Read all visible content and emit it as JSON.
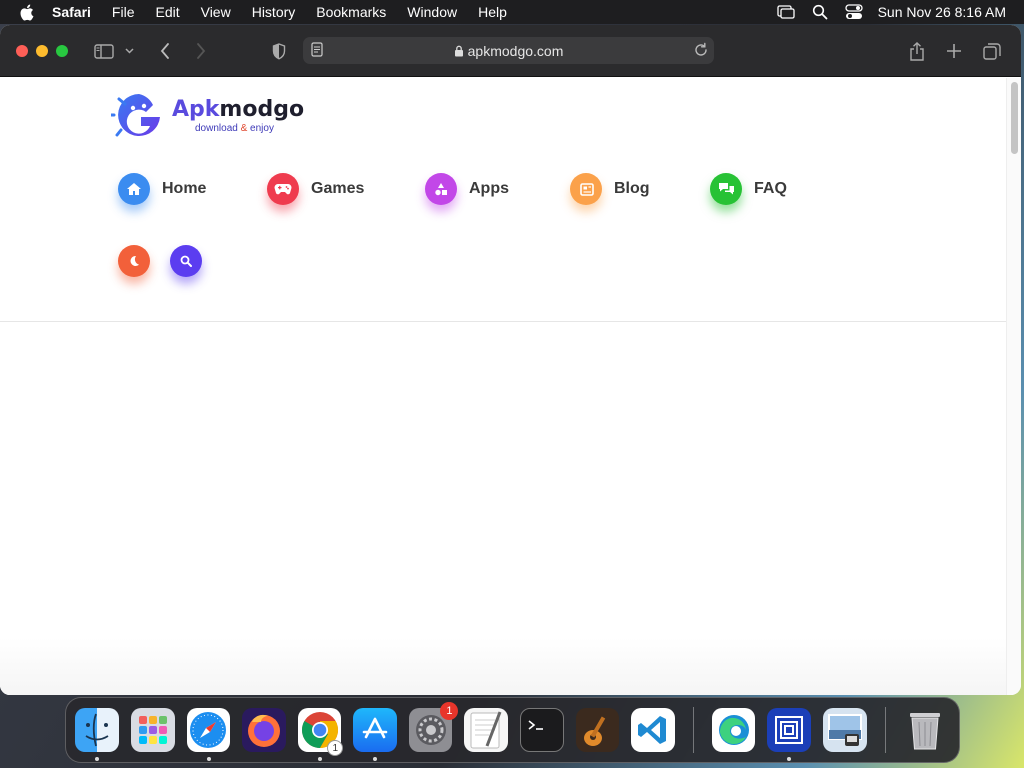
{
  "menubar": {
    "app_name": "Safari",
    "items": [
      "File",
      "Edit",
      "View",
      "History",
      "Bookmarks",
      "Window",
      "Help"
    ],
    "clock": "Sun Nov 26  8:16 AM"
  },
  "browser": {
    "url": "apkmodgo.com"
  },
  "site": {
    "logo_title_a": "Apk",
    "logo_title_b": "modgo",
    "tagline_a": "download",
    "tagline_amp": "&",
    "tagline_b": "enjoy",
    "nav": [
      {
        "label": "Home",
        "icon": "home-icon",
        "color": "#3b8cf0"
      },
      {
        "label": "Games",
        "icon": "gamepad-icon",
        "color": "#ef3b4e"
      },
      {
        "label": "Apps",
        "icon": "shapes-icon",
        "color": "#c247e8"
      },
      {
        "label": "Blog",
        "icon": "newspaper-icon",
        "color": "#fba14a"
      },
      {
        "label": "FAQ",
        "icon": "chat-icon",
        "color": "#27c235"
      }
    ],
    "actions": [
      {
        "icon": "moon-icon",
        "color": "#f2603a"
      },
      {
        "icon": "search-icon",
        "color": "#5b3df0"
      }
    ]
  },
  "dock": {
    "apps": [
      {
        "name": "Finder",
        "icon": "finder-icon"
      },
      {
        "name": "Launchpad",
        "icon": "launchpad-icon"
      },
      {
        "name": "Safari",
        "icon": "safari-icon"
      },
      {
        "name": "Firefox",
        "icon": "firefox-icon"
      },
      {
        "name": "Chrome",
        "icon": "chrome-icon",
        "badge": "1"
      },
      {
        "name": "App Store",
        "icon": "app-store-icon"
      },
      {
        "name": "System Settings",
        "icon": "settings-icon",
        "badge": "1"
      },
      {
        "name": "TextEdit",
        "icon": "textedit-icon"
      },
      {
        "name": "Terminal",
        "icon": "terminal-icon"
      },
      {
        "name": "GarageBand",
        "icon": "garageband-icon"
      },
      {
        "name": "Visual Studio Code",
        "icon": "vscode-icon"
      },
      {
        "name": "Microsoft Edge",
        "icon": "edge-icon"
      },
      {
        "name": "Screen Sharing",
        "icon": "screen-sharing-icon"
      },
      {
        "name": "Preview",
        "icon": "preview-icon"
      },
      {
        "name": "Trash",
        "icon": "trash-icon"
      }
    ]
  }
}
